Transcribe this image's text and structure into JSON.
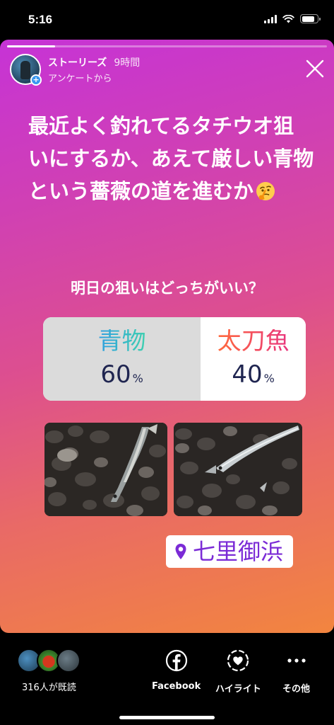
{
  "status_bar": {
    "time": "5:16",
    "icons": [
      "cellular-signal-icon",
      "wifi-icon",
      "battery-icon"
    ],
    "battery_level": 0.85
  },
  "story": {
    "progress": 0.15,
    "author": "ストーリーズ",
    "time_ago": "9時間",
    "subtitle": "アンケートから",
    "caption": "最近よく釣れてるタチウオ狙いにするか、あえて厳しい青物という薔薇の道を進むか",
    "caption_emoji": "thinking-face-emoji",
    "poll": {
      "question": "明日の狙いはどっちがいい？",
      "options": [
        {
          "label": "青物",
          "percent": "60",
          "unit": "%"
        },
        {
          "label": "太刀魚",
          "percent": "40",
          "unit": "%"
        }
      ]
    },
    "photos": [
      "yellowtail-on-pebbles-photo",
      "cutlassfish-on-pebbles-photo"
    ],
    "location_sticker": "七里御浜"
  },
  "colors": {
    "gradient_top": "#c633d6",
    "gradient_bottom": "#f2853f",
    "poll_left_bg": "#dbdbdb",
    "poll_number": "#1f2550",
    "location_text": "#7b2bd6"
  },
  "bottom_bar": {
    "viewers_label": "316人が既読",
    "actions": [
      {
        "icon": "facebook-icon",
        "label": "Facebook"
      },
      {
        "icon": "highlight-heart-icon",
        "label": "ハイライト"
      },
      {
        "icon": "more-dots-icon",
        "label": "その他"
      }
    ]
  }
}
